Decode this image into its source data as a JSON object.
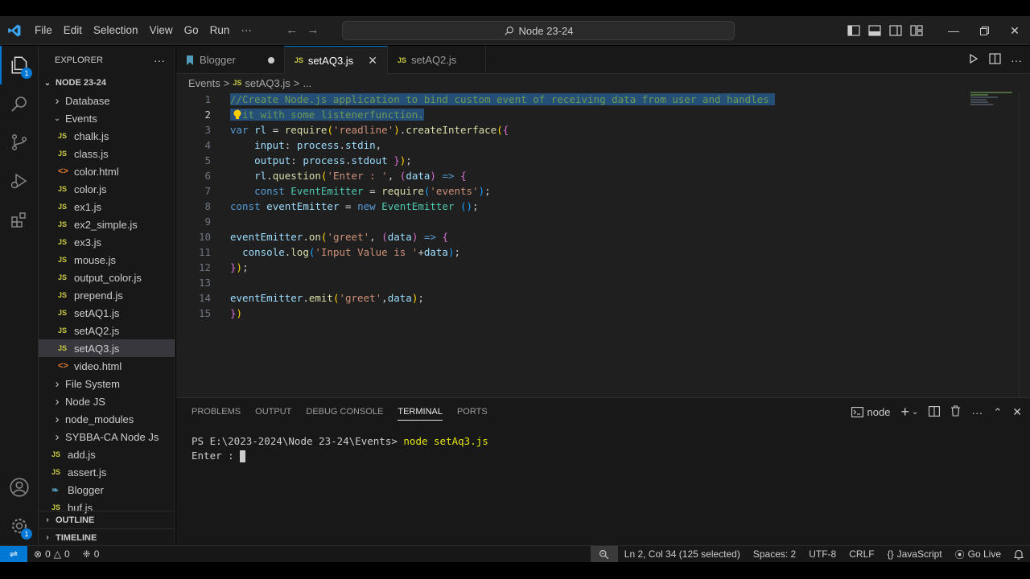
{
  "titlebar": {
    "menu": [
      "File",
      "Edit",
      "Selection",
      "View",
      "Go",
      "Run",
      "···"
    ],
    "search_text": "Node 23-24"
  },
  "activity": {
    "explorer_badge": "1",
    "manage_badge": "1"
  },
  "sidebar": {
    "header": "EXPLORER",
    "more": "···",
    "root": "NODE 23-24",
    "items": [
      {
        "label": "Database",
        "type": "folder"
      },
      {
        "label": "Events",
        "type": "folder-open"
      },
      {
        "label": "chalk.js",
        "type": "js"
      },
      {
        "label": "class.js",
        "type": "js"
      },
      {
        "label": "color.html",
        "type": "html"
      },
      {
        "label": "color.js",
        "type": "js"
      },
      {
        "label": "ex1.js",
        "type": "js"
      },
      {
        "label": "ex2_simple.js",
        "type": "js"
      },
      {
        "label": "ex3.js",
        "type": "js"
      },
      {
        "label": "mouse.js",
        "type": "js"
      },
      {
        "label": "output_color.js",
        "type": "js"
      },
      {
        "label": "prepend.js",
        "type": "js"
      },
      {
        "label": "setAQ1.js",
        "type": "js"
      },
      {
        "label": "setAQ2.js",
        "type": "js"
      },
      {
        "label": "setAQ3.js",
        "type": "js"
      },
      {
        "label": "video.html",
        "type": "html"
      },
      {
        "label": "File System",
        "type": "folder"
      },
      {
        "label": "Node JS",
        "type": "folder"
      },
      {
        "label": "node_modules",
        "type": "folder"
      },
      {
        "label": "SYBBA-CA Node Js",
        "type": "folder"
      },
      {
        "label": "add.js",
        "type": "js"
      },
      {
        "label": "assert.js",
        "type": "js"
      },
      {
        "label": "Blogger",
        "type": "md"
      },
      {
        "label": "buf.js",
        "type": "js"
      }
    ],
    "outline": "OUTLINE",
    "timeline": "TIMELINE"
  },
  "tabs": [
    {
      "label": "Blogger",
      "icon": "JS"
    },
    {
      "label": "setAQ3.js",
      "icon": "JS"
    },
    {
      "label": "setAQ2.js",
      "icon": "JS"
    }
  ],
  "breadcrumb": {
    "folder": "Events",
    "sep": ">",
    "icon": "JS",
    "file": "setAQ3.js",
    "ellipsis": "..."
  },
  "editor": {
    "line_numbers": [
      "1",
      "2",
      "3",
      "4",
      "5",
      "6",
      "7",
      "8",
      "9",
      "10",
      "11",
      "12",
      "13",
      "14",
      "15"
    ],
    "l1": "//Create Node.js application to bind custom event of receiving data from user and handles ",
    "l2": "it with some listenerfunction.",
    "l3_var": "var",
    "l3_rl": " rl ",
    "l3_eq": "= ",
    "l3_req": "require",
    "l3_p1": "(",
    "l3_str": "'readline'",
    "l3_p2": ")",
    "l3_dot": ".",
    "l3_fn": "createInterface",
    "l3_p3": "(",
    "l3_b": "{",
    "l4_key": "input",
    "l4_rest": ": ",
    "l4_obj": "process",
    "l4_dot": ".",
    "l4_prop": "stdin",
    "l4_comma": ",",
    "l5_key": "output",
    "l5_rest": ": ",
    "l5_obj": "process",
    "l5_dot": ".",
    "l5_prop": "stdout",
    "l5_b": " }",
    "l5_p": ")",
    "l5_semi": ";",
    "l6_obj": "rl",
    "l6_dot": ".",
    "l6_fn": "question",
    "l6_p": "(",
    "l6_str": "'Enter : '",
    "l6_c": ", ",
    "l6_p2": "(",
    "l6_arg": "data",
    "l6_p3": ")",
    "l6_arrow": " => ",
    "l6_b": "{",
    "l7_kw": "const",
    "l7_cls": " EventEmitter ",
    "l7_eq": "= ",
    "l7_req": "require",
    "l7_p": "(",
    "l7_str": "'events'",
    "l7_p2": ")",
    "l7_semi": ";",
    "l8_kw": "const",
    "l8_var": " eventEmitter ",
    "l8_eq": "= ",
    "l8_new": "new",
    "l8_cls": " EventEmitter ",
    "l8_p": "()",
    "l8_semi": ";",
    "l10_obj": "eventEmitter",
    "l10_dot": ".",
    "l10_fn": "on",
    "l10_p": "(",
    "l10_str": "'greet'",
    "l10_c": ", ",
    "l10_p2": "(",
    "l10_arg": "data",
    "l10_p3": ")",
    "l10_arrow": " => ",
    "l10_b": "{",
    "l11_obj": "console",
    "l11_dot": ".",
    "l11_fn": "log",
    "l11_p": "(",
    "l11_str": "'Input Value is '",
    "l11_plus": "+",
    "l11_arg": "data",
    "l11_p2": ")",
    "l11_semi": ";",
    "l12_b": "}",
    "l12_p": ")",
    "l12_semi": ";",
    "l14_obj": "eventEmitter",
    "l14_dot": ".",
    "l14_fn": "emit",
    "l14_p": "(",
    "l14_str": "'greet'",
    "l14_c": ",",
    "l14_arg": "data",
    "l14_p2": ")",
    "l14_semi": ";",
    "l15_b": "}",
    "l15_p": ")"
  },
  "panel": {
    "tabs": [
      "PROBLEMS",
      "OUTPUT",
      "DEBUG CONSOLE",
      "TERMINAL",
      "PORTS"
    ],
    "active_tab": "TERMINAL",
    "terminal_name": "node",
    "line1_prompt": "PS E:\\2023-2024\\Node 23-24\\Events> ",
    "line1_cmd": "node setAq3.js",
    "line2": "Enter : "
  },
  "statusbar": {
    "errors": "0",
    "warnings": "0",
    "ports": "0",
    "position": "Ln 2, Col 34 (125 selected)",
    "spaces": "Spaces: 2",
    "encoding": "UTF-8",
    "eol": "CRLF",
    "language_brace": "{}",
    "language": "JavaScript",
    "golive": "Go Live"
  },
  "colors": {
    "accent": "#0078d4",
    "background": "#1f1f1f",
    "sidebar": "#181818",
    "selection": "#264f78"
  }
}
